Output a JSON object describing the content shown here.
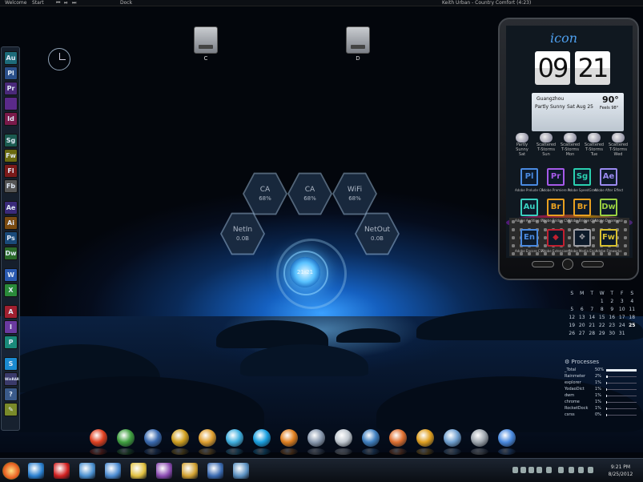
{
  "topbar": {
    "left_items": [
      "Welcome",
      "Start",
      "⏮",
      "⏯",
      "⏭",
      "Dock"
    ],
    "now_playing": "Keith Urban - Country Comfort (4:23)"
  },
  "left_dock": {
    "icons": [
      {
        "label": "Au",
        "color": "#1d6b7a"
      },
      {
        "label": "Pl",
        "color": "#2a4f8a"
      },
      {
        "label": "Pr",
        "color": "#4a2a7a"
      },
      {
        "label": "",
        "color": "#5a2a8a"
      },
      {
        "label": "Id",
        "color": "#7a1a4a"
      },
      {
        "label": "Sg",
        "color": "#1a5a50"
      },
      {
        "label": "Fw",
        "color": "#6a6a10"
      },
      {
        "label": "Fl",
        "color": "#7a1a1a"
      },
      {
        "label": "Fb",
        "color": "#555555"
      },
      {
        "label": "Ae",
        "color": "#3a2a7a"
      },
      {
        "label": "Ai",
        "color": "#7a4a10"
      },
      {
        "label": "Ps",
        "color": "#1a4a7a"
      },
      {
        "label": "Dw",
        "color": "#2a6a2a"
      },
      {
        "label": "W",
        "color": "#2a5ab0"
      },
      {
        "label": "X",
        "color": "#2a8a3a"
      },
      {
        "label": "A",
        "color": "#a02030"
      },
      {
        "label": "I",
        "color": "#6a3aa0"
      },
      {
        "label": "P",
        "color": "#1a8a7a"
      },
      {
        "label": "S",
        "color": "#1a8ad0"
      },
      {
        "label": "WinRAR",
        "color": "#3a3a6a"
      },
      {
        "label": "?",
        "color": "#3a5a8a"
      },
      {
        "label": "✎",
        "color": "#7a8a2a"
      }
    ]
  },
  "desktop": {
    "drives": [
      {
        "label": "C"
      },
      {
        "label": "D"
      }
    ]
  },
  "meters": [
    {
      "title": "CA",
      "value": "68%"
    },
    {
      "title": "CA",
      "value": "68%"
    },
    {
      "title": "WiFi",
      "value": "68%"
    },
    {
      "title": "NetIn",
      "value": "0.0B"
    },
    {
      "title": "NetOut",
      "value": "0.0B"
    }
  ],
  "center_core": {
    "time": "21:21"
  },
  "phone": {
    "logo": "icon",
    "hour": "09",
    "minute": "21",
    "weather": {
      "city": "Guangzhou",
      "date": "Sat Aug 25",
      "condition": "Partly Sunny",
      "temp": "90°",
      "feels": "Feels 98°"
    },
    "forecast": [
      {
        "day": "Sat",
        "desc": "Partly Sunny"
      },
      {
        "day": "Sun",
        "desc": "Scattered T-Storms"
      },
      {
        "day": "Mon",
        "desc": "Scattered T-Storms"
      },
      {
        "day": "Tue",
        "desc": "Scattered T-Storms"
      },
      {
        "day": "Wed",
        "desc": "Scattered T-Storms"
      }
    ],
    "apps": [
      {
        "label": "Pl",
        "name": "Adobe Prelude CS6",
        "color": "#4a8ae0"
      },
      {
        "label": "Pr",
        "name": "Adobe Premiere Pro CS6",
        "color": "#a55ae8"
      },
      {
        "label": "Sg",
        "name": "Adobe SpeedGrade",
        "color": "#2ad0b0"
      },
      {
        "label": "Ae",
        "name": "Adobe After Effects",
        "color": "#9a8af0"
      },
      {
        "label": "Au",
        "name": "Adobe Audition CS6",
        "color": "#3ad0c0"
      },
      {
        "label": "Br",
        "name": "Adobe Bridge CS6",
        "color": "#e8a020"
      },
      {
        "label": "Br",
        "name": "Adobe Bridge CS6 64",
        "color": "#e8a020"
      },
      {
        "label": "Dw",
        "name": "Adobe Dreamweaver",
        "color": "#9ad040"
      },
      {
        "label": "En",
        "name": "Adobe Encore CS6",
        "color": "#4a8ae0"
      },
      {
        "label": "◆",
        "name": "Adobe Extension Mgr",
        "color": "#c02030"
      },
      {
        "label": "❖",
        "name": "Adobe Media Encoder",
        "color": "#9a9aa0"
      },
      {
        "label": "Fw",
        "name": "Adobe Fireworks",
        "color": "#d8c030"
      }
    ]
  },
  "calendar": {
    "weekdays": [
      "S",
      "M",
      "T",
      "W",
      "T",
      "F",
      "S"
    ],
    "weeks": [
      [
        "",
        "",
        "",
        "1",
        "2",
        "3",
        "4"
      ],
      [
        "5",
        "6",
        "7",
        "8",
        "9",
        "10",
        "11"
      ],
      [
        "12",
        "13",
        "14",
        "15",
        "16",
        "17",
        "18"
      ],
      [
        "19",
        "20",
        "21",
        "22",
        "23",
        "24",
        "25"
      ],
      [
        "26",
        "27",
        "28",
        "29",
        "30",
        "31",
        ""
      ]
    ]
  },
  "processes": {
    "title": "Processes",
    "items": [
      {
        "name": "_Total",
        "pct": "50%",
        "level": 0.5
      },
      {
        "name": "Rainmeter",
        "pct": "2%",
        "level": 0.02
      },
      {
        "name": "explorer",
        "pct": "1%",
        "level": 0.01
      },
      {
        "name": "YodaoDict",
        "pct": "1%",
        "level": 0.01
      },
      {
        "name": "dwm",
        "pct": "1%",
        "level": 0.01
      },
      {
        "name": "chrome",
        "pct": "1%",
        "level": 0.01
      },
      {
        "name": "RocketDock",
        "pct": "1%",
        "level": 0.01
      },
      {
        "name": "csrss",
        "pct": "0%",
        "level": 0
      }
    ]
  },
  "dock": {
    "icons": [
      {
        "name": "windows-logo-icon",
        "color": "#e04020"
      },
      {
        "name": "windows-orb-icon",
        "color": "#40a040"
      },
      {
        "name": "computer-icon",
        "color": "#3a6ab0"
      },
      {
        "name": "burn-disc-icon",
        "color": "#d0a020"
      },
      {
        "name": "tools-icon",
        "color": "#e0a030"
      },
      {
        "name": "network-icon",
        "color": "#40b0e0"
      },
      {
        "name": "skype-icon",
        "color": "#1aa0e0"
      },
      {
        "name": "media-player-icon",
        "color": "#e08020"
      },
      {
        "name": "rocket-icon",
        "color": "#8a9ab0"
      },
      {
        "name": "document-icon",
        "color": "#c0c8d0"
      },
      {
        "name": "globe-icon",
        "color": "#4080c0"
      },
      {
        "name": "firefox-icon",
        "color": "#e07030"
      },
      {
        "name": "vmware-icon",
        "color": "#e0a020"
      },
      {
        "name": "monitor-icon",
        "color": "#70a0d0"
      },
      {
        "name": "recycle-bin-icon",
        "color": "#a0a8b0"
      },
      {
        "name": "desktop-icon",
        "color": "#4a8ae0"
      }
    ]
  },
  "taskbar": {
    "pinned": [
      {
        "name": "ie-icon",
        "color": "#2a80d0"
      },
      {
        "name": "opera-icon",
        "color": "#d02020"
      },
      {
        "name": "network-globe-icon",
        "color": "#4a90d0"
      },
      {
        "name": "mail-icon",
        "color": "#4a8ad0"
      },
      {
        "name": "explorer-folder-icon",
        "color": "#e0c040"
      },
      {
        "name": "media-center-icon",
        "color": "#8a4ab0"
      },
      {
        "name": "tools-task-icon",
        "color": "#d0a030"
      },
      {
        "name": "photoshop-task-icon",
        "color": "#3a6ab0"
      },
      {
        "name": "globe-task-icon",
        "color": "#5a90c0"
      }
    ],
    "time": "9:21 PM",
    "date": "8/25/2012"
  }
}
